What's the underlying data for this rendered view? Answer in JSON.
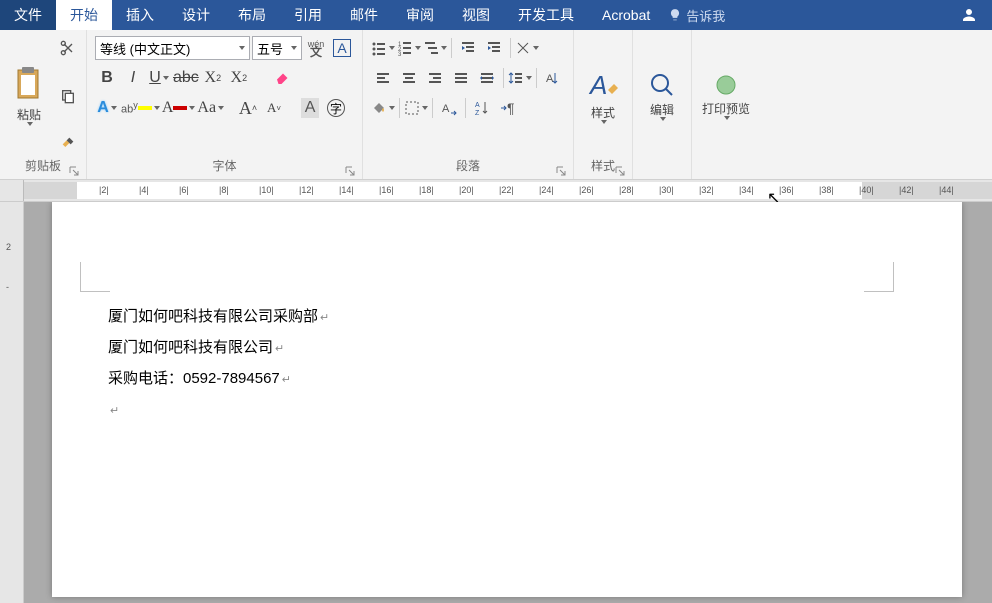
{
  "tabs": {
    "file": "文件",
    "home": "开始",
    "insert": "插入",
    "design": "设计",
    "layout": "布局",
    "references": "引用",
    "mailings": "邮件",
    "review": "审阅",
    "view": "视图",
    "developer": "开发工具",
    "acrobat": "Acrobat",
    "tellme": "告诉我"
  },
  "clipboard": {
    "label": "剪贴板",
    "paste": "粘贴"
  },
  "font": {
    "label": "字体",
    "name": "等线 (中文正文)",
    "size": "五号"
  },
  "paragraph": {
    "label": "段落"
  },
  "styles": {
    "label": "样式",
    "btn": "样式"
  },
  "editing": {
    "label": "编辑"
  },
  "printpreview": {
    "label": "打印预览"
  },
  "ruler_numbers": [
    "2",
    "4",
    "6",
    "8",
    "10",
    "12",
    "14",
    "16",
    "18",
    "20",
    "22",
    "24",
    "26",
    "28",
    "30",
    "32",
    "34",
    "36",
    "38",
    "40",
    "42",
    "44"
  ],
  "doc": {
    "line1": "厦门如何吧科技有限公司采购部",
    "line2": "厦门如何吧科技有限公司",
    "line3": "采购电话：0592-7894567"
  }
}
